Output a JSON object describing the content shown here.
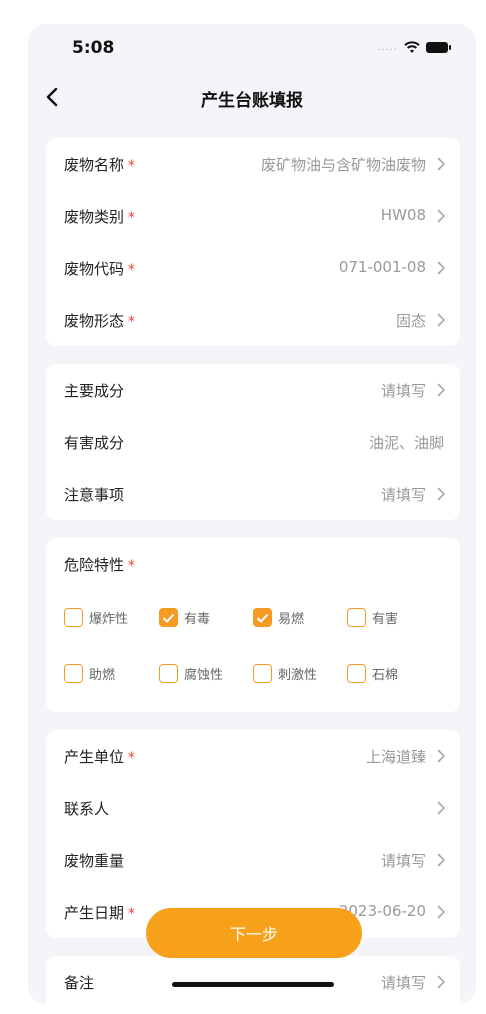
{
  "status": {
    "time": "5:08",
    "signal": "....."
  },
  "nav": {
    "title": "产生台账填报"
  },
  "card1": [
    {
      "label": "废物名称",
      "required": "*",
      "value": "废矿物油与含矿物油废物"
    },
    {
      "label": "废物类别",
      "required": "*",
      "value": "HW08"
    },
    {
      "label": "废物代码",
      "required": "*",
      "value": "071-001-08"
    },
    {
      "label": "废物形态",
      "required": "*",
      "value": "固态"
    }
  ],
  "card2": [
    {
      "label": "主要成分",
      "value": "请填写"
    },
    {
      "label": "有害成分",
      "value": "油泥、油脚"
    },
    {
      "label": "注意事项",
      "value": "请填写"
    }
  ],
  "hazard": {
    "label": "危险特性",
    "required": "*",
    "options": [
      {
        "label": "爆炸性",
        "checked": false
      },
      {
        "label": "有毒",
        "checked": true
      },
      {
        "label": "易燃",
        "checked": true
      },
      {
        "label": "有害",
        "checked": false
      },
      {
        "label": "助燃",
        "checked": false
      },
      {
        "label": "腐蚀性",
        "checked": false
      },
      {
        "label": "刺激性",
        "checked": false
      },
      {
        "label": "石棉",
        "checked": false
      }
    ]
  },
  "card4": [
    {
      "label": "产生单位",
      "required": "*",
      "value": "上海道臻"
    },
    {
      "label": "联系人",
      "value": ""
    },
    {
      "label": "废物重量",
      "value": "请填写"
    },
    {
      "label": "产生日期",
      "required": "*",
      "value": "2023-06-20"
    }
  ],
  "card5": [
    {
      "label": "备注",
      "value": "请填写"
    }
  ],
  "next_button": "下一步",
  "colors": {
    "accent": "#f7a11b",
    "required": "#ff3b30",
    "background": "#f4f4f9"
  }
}
